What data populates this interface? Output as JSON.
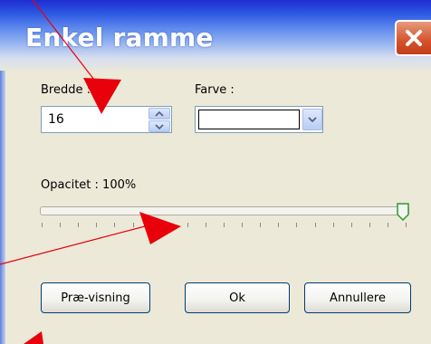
{
  "window": {
    "title": "Enkel ramme",
    "close_glyph": "✕"
  },
  "width_field": {
    "label": "Bredde :",
    "value": "16",
    "up_icon": "triangle-up",
    "down_icon": "triangle-down"
  },
  "color_field": {
    "label": "Farve :",
    "selected": "",
    "dropdown_icon": "chevron-down"
  },
  "opacity": {
    "label": "Opacitet : 100%",
    "value_percent": 100,
    "tick_count": 21
  },
  "buttons": {
    "preview": "Præ-visning",
    "ok": "Ok",
    "cancel": "Annullere"
  },
  "annotations": {
    "arrow_color": "#e8000a",
    "arrowhead_icon": "red-triangle"
  },
  "colors": {
    "title_gradient_top": "#1f2cd0",
    "dialog_bg": "#ece9d8",
    "close_button": "#d5522b",
    "button_border": "#003c74"
  }
}
